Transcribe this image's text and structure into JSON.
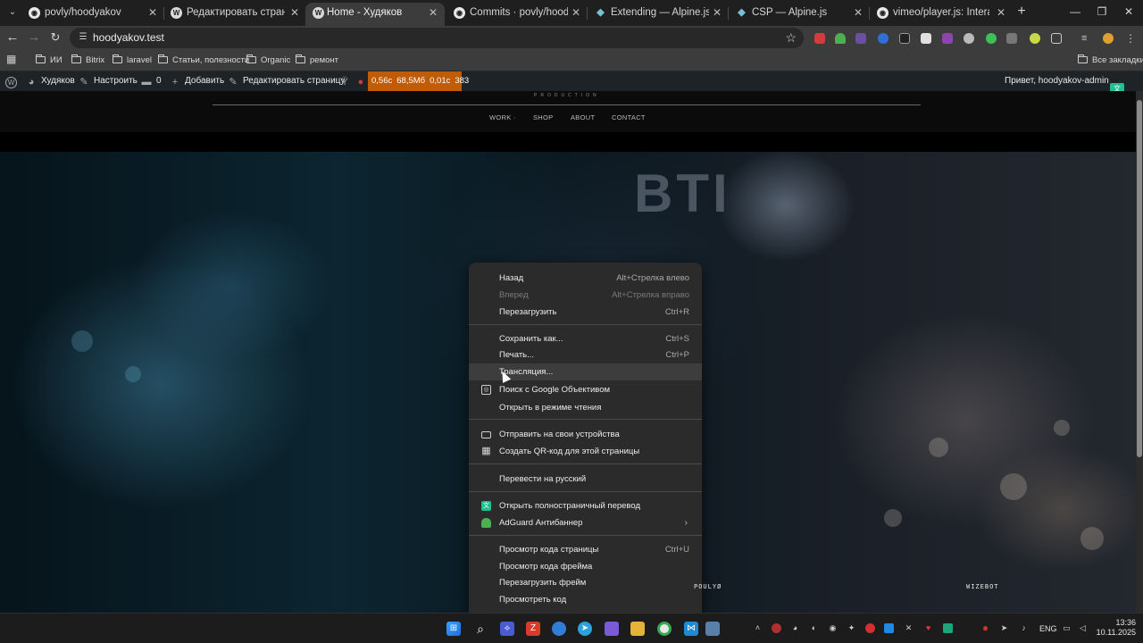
{
  "tabs": [
    {
      "title": "povly/hoodyakov",
      "icon": "github-icon",
      "active": false
    },
    {
      "title": "Редактировать страницу “Hom",
      "icon": "wordpress-icon",
      "active": false
    },
    {
      "title": "Home - Худяков",
      "icon": "wordpress-icon",
      "active": true
    },
    {
      "title": "Commits · povly/hoodyakov",
      "icon": "github-icon",
      "active": false
    },
    {
      "title": "Extending — Alpine.js",
      "icon": "alpine-icon",
      "active": false
    },
    {
      "title": "CSP — Alpine.js",
      "icon": "alpine-icon",
      "active": false
    },
    {
      "title": "vimeo/player.js: Interact with a",
      "icon": "github-icon",
      "active": false
    }
  ],
  "address": {
    "url": "hoodyakov.test"
  },
  "bookmarks": {
    "items": [
      "ИИ",
      "Bitrix",
      "laravel",
      "Статьи, полезности",
      "Organic",
      "ремонт"
    ],
    "all_label": "Все закладки"
  },
  "adminbar": {
    "site": "Худяков",
    "customize": "Настроить",
    "comments": "0",
    "add_new": "Добавить",
    "edit_page": "Редактировать страницу",
    "qm": [
      "0,56с",
      "68,5Мб",
      "0,01с",
      "383"
    ],
    "greeting": "Привет, hoodyakov-admin"
  },
  "site": {
    "tagline": "PRODUCTION",
    "menu": [
      "WORK ·",
      "SHOP",
      "ABOUT",
      "CONTACT"
    ],
    "hero_sign": "BTI"
  },
  "context_menu": {
    "items": [
      {
        "label": "Назад",
        "shortcut": "Alt+Стрелка влево"
      },
      {
        "label": "Вперед",
        "shortcut": "Alt+Стрелка вправо",
        "disabled": true
      },
      {
        "label": "Перезагрузить",
        "shortcut": "Ctrl+R"
      },
      {
        "label": "Сохранить как...",
        "shortcut": "Ctrl+S"
      },
      {
        "label": "Печать...",
        "shortcut": "Ctrl+P"
      },
      {
        "label": "Трансляция...",
        "hover": true
      },
      {
        "label": "Поиск с Google Объективом",
        "icon": "google-lens-icon"
      },
      {
        "label": "Открыть в режиме чтения"
      },
      {
        "label": "Отправить на свои устройства",
        "icon": "send-to-devices-icon"
      },
      {
        "label": "Создать QR-код для этой страницы",
        "icon": "qr-code-icon"
      },
      {
        "label": "Перевести на русский"
      },
      {
        "label": "Открыть полностраничный перевод",
        "icon": "translate-extension-icon"
      },
      {
        "label": "AdGuard Антибаннер",
        "icon": "adguard-icon",
        "submenu": true
      },
      {
        "label": "Просмотр кода страницы",
        "shortcut": "Ctrl+U"
      },
      {
        "label": "Просмотр кода фрейма"
      },
      {
        "label": "Перезагрузить фрейм"
      },
      {
        "label": "Просмотреть код"
      }
    ]
  },
  "stream_overlay": {
    "left_name": "POULYØ",
    "right_name": "WIZEBOT"
  },
  "taskbar": {
    "lang": "ENG",
    "time": "13:36",
    "date": "10.11.2025"
  },
  "colors": {
    "qm_bar": "#c05b07",
    "adminbar": "#1d2327",
    "menu_bg": "#2b2b2b"
  }
}
